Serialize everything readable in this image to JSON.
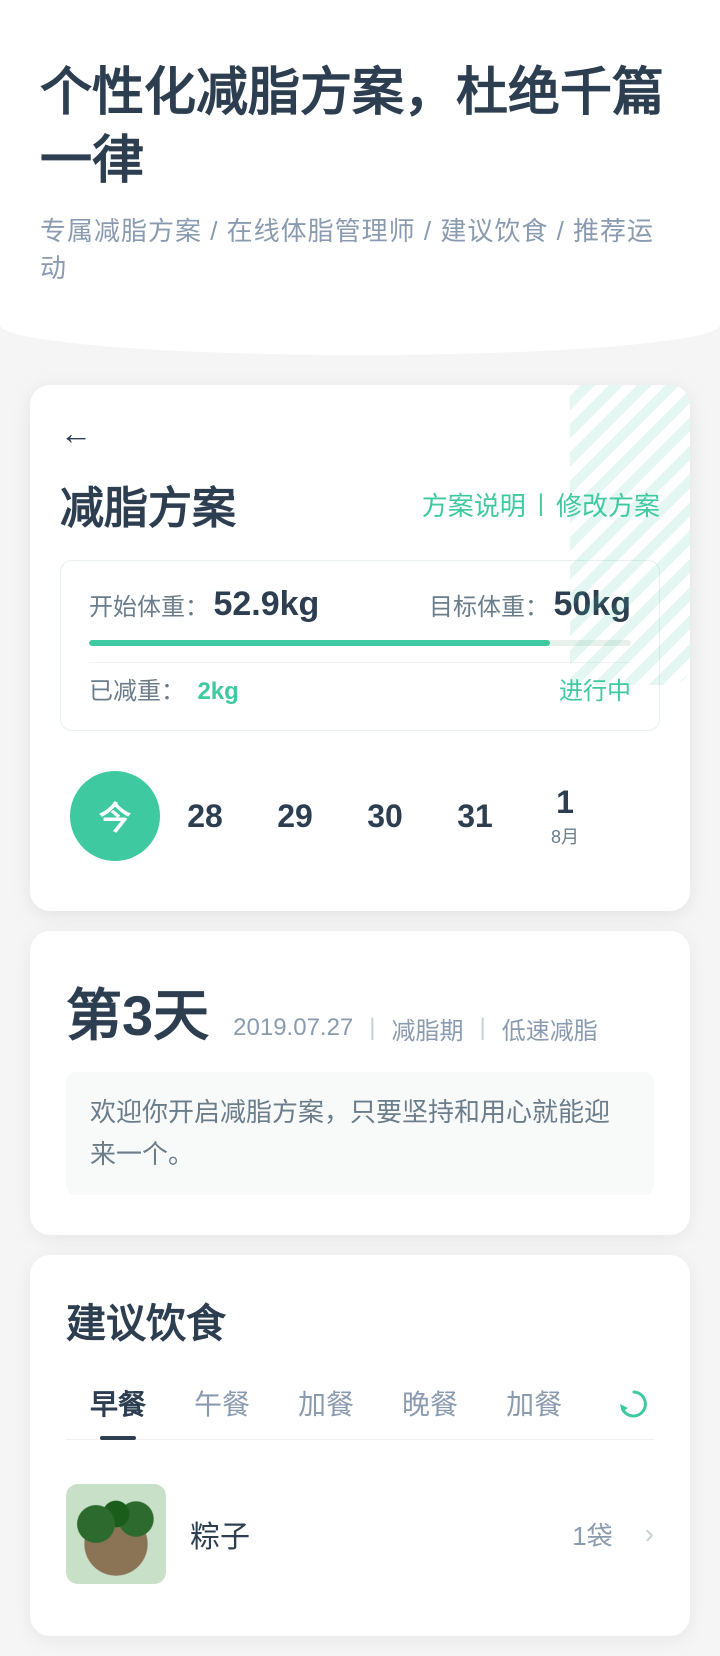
{
  "header": {
    "title": "个性化减脂方案，杜绝千篇一律",
    "subtitle": "专属减脂方案 / 在线体脂管理师 / 建议饮食 / 推荐运动"
  },
  "card": {
    "back_label": "←",
    "title": "减脂方案",
    "action1": "方案说明",
    "action_divider": "|",
    "action2": "修改方案",
    "weight": {
      "start_label": "开始体重：",
      "start_value": "52.9kg",
      "target_label": "目标体重：",
      "target_value": "50kg",
      "progress_percent": 85,
      "reduced_label": "已减重：",
      "reduced_value": "2kg",
      "status": "进行中"
    }
  },
  "dates": [
    {
      "label": "今",
      "sub": "",
      "active": true
    },
    {
      "label": "28",
      "sub": "",
      "active": false
    },
    {
      "label": "29",
      "sub": "",
      "active": false
    },
    {
      "label": "30",
      "sub": "",
      "active": false
    },
    {
      "label": "31",
      "sub": "",
      "active": false
    },
    {
      "label": "1",
      "sub": "8月",
      "active": false
    }
  ],
  "day_section": {
    "day_label": "第3天",
    "date": "2019.07.27",
    "divider": "|",
    "tag1": "减脂期",
    "divider2": "|",
    "tag2": "低速减脂",
    "description": "欢迎你开启减脂方案，只要坚持和用心就能迎来一个。"
  },
  "diet_section": {
    "title": "建议饮食",
    "tabs": [
      {
        "label": "早餐",
        "active": true
      },
      {
        "label": "午餐",
        "active": false
      },
      {
        "label": "加餐",
        "active": false
      },
      {
        "label": "晚餐",
        "active": false
      },
      {
        "label": "加餐",
        "active": false
      }
    ],
    "food_items": [
      {
        "name": "粽子",
        "amount": "1袋",
        "has_arrow": true
      }
    ]
  }
}
